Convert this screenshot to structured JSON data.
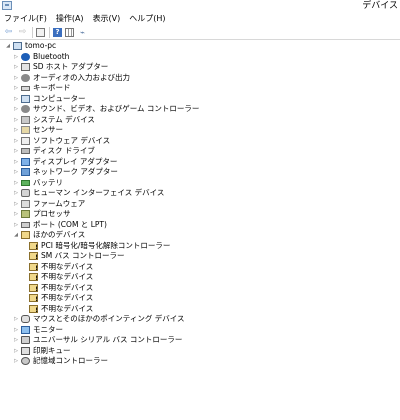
{
  "window": {
    "title": "デバイス"
  },
  "menu": [
    "ファイル(F)",
    "操作(A)",
    "表示(V)",
    "ヘルプ(H)"
  ],
  "toolbar": {
    "buttons": [
      {
        "name": "back-button",
        "glyph": "⇦",
        "icon": "arrow-left-icon"
      },
      {
        "name": "forward-button",
        "glyph": "⇨",
        "icon": "arrow-right-icon"
      },
      {
        "name": "show-hide-console-tree-button",
        "glyph": "",
        "icon": "panel-icon"
      },
      {
        "name": "help-button",
        "glyph": "?",
        "icon": "help-icon"
      },
      {
        "name": "properties-button",
        "glyph": "",
        "icon": "grid-icon"
      },
      {
        "name": "scan-hardware-button",
        "glyph": "⌁",
        "icon": "monitor-scan-icon"
      }
    ]
  },
  "tree": {
    "items": [
      {
        "label": "tomo-pc",
        "level": 0,
        "expander": "◢",
        "icon": "computer-icon",
        "cls": "ic-computer"
      },
      {
        "label": "Bluetooth",
        "level": 1,
        "expander": "▷",
        "icon": "bluetooth-icon",
        "cls": "ic-bt"
      },
      {
        "label": "SD ホスト アダプター",
        "level": 1,
        "expander": "▷",
        "icon": "sd-card-icon",
        "cls": "ic-sd"
      },
      {
        "label": "オーディオの入力および出力",
        "level": 1,
        "expander": "▷",
        "icon": "speaker-icon",
        "cls": "ic-audio"
      },
      {
        "label": "キーボード",
        "level": 1,
        "expander": "▷",
        "icon": "keyboard-icon",
        "cls": "ic-kbd"
      },
      {
        "label": "コンピューター",
        "level": 1,
        "expander": "▷",
        "icon": "computer-icon",
        "cls": "ic-computer"
      },
      {
        "label": "サウンド、ビデオ、およびゲーム コントローラー",
        "level": 1,
        "expander": "▷",
        "icon": "sound-icon",
        "cls": "ic-audio"
      },
      {
        "label": "システム デバイス",
        "level": 1,
        "expander": "▷",
        "icon": "system-device-icon",
        "cls": "ic-sys"
      },
      {
        "label": "センサー",
        "level": 1,
        "expander": "▷",
        "icon": "sensor-icon",
        "cls": "ic-sensor"
      },
      {
        "label": "ソフトウェア デバイス",
        "level": 1,
        "expander": "▷",
        "icon": "software-device-icon",
        "cls": "ic-soft"
      },
      {
        "label": "ディスク ドライブ",
        "level": 1,
        "expander": "▷",
        "icon": "disk-drive-icon",
        "cls": "ic-disk"
      },
      {
        "label": "ディスプレイ アダプター",
        "level": 1,
        "expander": "▷",
        "icon": "display-adapter-icon",
        "cls": "ic-display"
      },
      {
        "label": "ネットワーク アダプター",
        "level": 1,
        "expander": "▷",
        "icon": "network-adapter-icon",
        "cls": "ic-net"
      },
      {
        "label": "バッテリ",
        "level": 1,
        "expander": "▷",
        "icon": "battery-icon",
        "cls": "ic-battery"
      },
      {
        "label": "ヒューマン インターフェイス デバイス",
        "level": 1,
        "expander": "▷",
        "icon": "hid-icon",
        "cls": "ic-hid"
      },
      {
        "label": "ファームウェア",
        "level": 1,
        "expander": "▷",
        "icon": "firmware-icon",
        "cls": "ic-fw"
      },
      {
        "label": "プロセッサ",
        "level": 1,
        "expander": "▷",
        "icon": "processor-icon",
        "cls": "ic-cpu"
      },
      {
        "label": "ポート (COM と LPT)",
        "level": 1,
        "expander": "▷",
        "icon": "port-icon",
        "cls": "ic-port"
      },
      {
        "label": "ほかのデバイス",
        "level": 1,
        "expander": "◢",
        "icon": "other-devices-icon",
        "cls": "ic-other"
      },
      {
        "label": "PCI 暗号化/暗号化解除コントローラー",
        "level": 2,
        "expander": "",
        "icon": "unknown-device-warning-icon",
        "cls": "ic-warn"
      },
      {
        "label": "SM バス コントローラー",
        "level": 2,
        "expander": "",
        "icon": "unknown-device-warning-icon",
        "cls": "ic-warn"
      },
      {
        "label": "不明なデバイス",
        "level": 2,
        "expander": "",
        "icon": "unknown-device-warning-icon",
        "cls": "ic-warn"
      },
      {
        "label": "不明なデバイス",
        "level": 2,
        "expander": "",
        "icon": "unknown-device-warning-icon",
        "cls": "ic-warn"
      },
      {
        "label": "不明なデバイス",
        "level": 2,
        "expander": "",
        "icon": "unknown-device-warning-icon",
        "cls": "ic-warn"
      },
      {
        "label": "不明なデバイス",
        "level": 2,
        "expander": "",
        "icon": "unknown-device-warning-icon",
        "cls": "ic-warn"
      },
      {
        "label": "不明なデバイス",
        "level": 2,
        "expander": "",
        "icon": "unknown-device-warning-icon",
        "cls": "ic-warn"
      },
      {
        "label": "マウスとそのほかのポインティング デバイス",
        "level": 1,
        "expander": "▷",
        "icon": "mouse-icon",
        "cls": "ic-mouse"
      },
      {
        "label": "モニター",
        "level": 1,
        "expander": "▷",
        "icon": "monitor-icon",
        "cls": "ic-monitor"
      },
      {
        "label": "ユニバーサル シリアル バス コントローラー",
        "level": 1,
        "expander": "▷",
        "icon": "usb-icon",
        "cls": "ic-usb"
      },
      {
        "label": "印刷キュー",
        "level": 1,
        "expander": "▷",
        "icon": "printer-icon",
        "cls": "ic-print"
      },
      {
        "label": "記憶域コントローラー",
        "level": 1,
        "expander": "▷",
        "icon": "storage-controller-icon",
        "cls": "ic-storage"
      }
    ]
  }
}
